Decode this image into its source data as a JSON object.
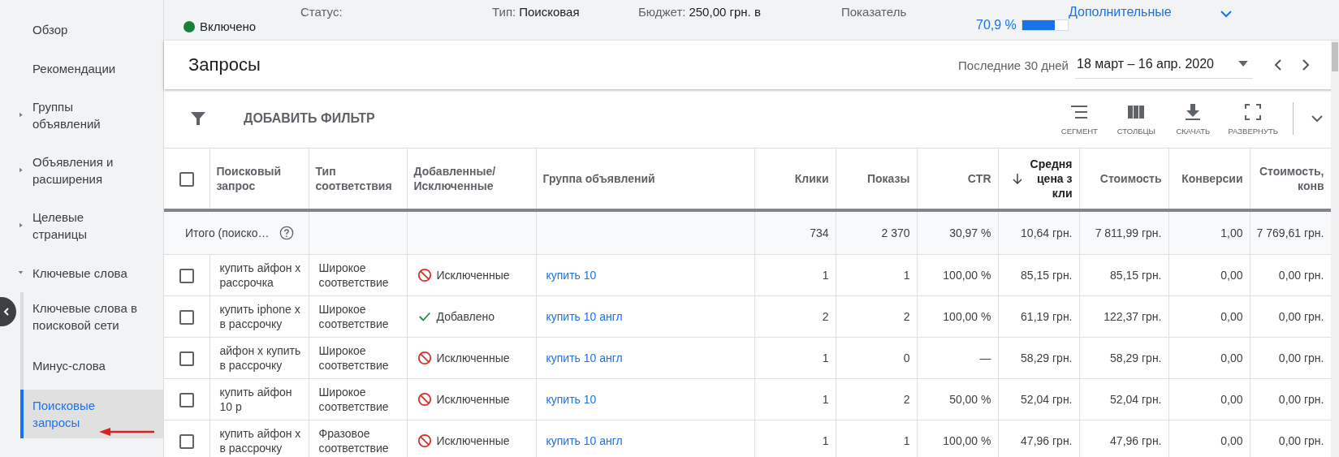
{
  "sidebar": {
    "items": [
      {
        "label": "Обзор",
        "kind": "page",
        "selected": false
      },
      {
        "label": "Рекомендации",
        "kind": "page",
        "selected": false
      },
      {
        "label": "Группы объявлений",
        "kind": "group",
        "expanded": false,
        "selected": false
      },
      {
        "label": "Объявления и расширения",
        "kind": "group",
        "expanded": false,
        "selected": false
      },
      {
        "label": "Целевые страницы",
        "kind": "group",
        "expanded": false,
        "selected": false
      },
      {
        "label": "Ключевые слова",
        "kind": "group",
        "expanded": true,
        "selected": false,
        "children": [
          {
            "label": "Ключевые слова в поисковой сети",
            "selected": false
          },
          {
            "label": "Минус-слова",
            "selected": false
          },
          {
            "label": "Поисковые запросы",
            "selected": true
          }
        ]
      }
    ]
  },
  "summary": {
    "status_label": "Статус:",
    "status_value": "Включено",
    "enabled": true,
    "type_label": "Тип:",
    "type_value": "Поисковая",
    "budget_label": "Бюджет:",
    "budget_value": "250,00 грн. в",
    "score_label": "Показатель",
    "score_value": "70,9 %",
    "level": 0.709,
    "more_link": "Дополнительные"
  },
  "page": {
    "title": "Запросы",
    "date_preset": "Последние 30 дней",
    "date_range": "18 март – 16 апр. 2020"
  },
  "toolbar": {
    "filter_button": "ДОБАВИТЬ ФИЛЬТР",
    "tools": [
      {
        "label": "СЕГМЕНТ",
        "kind": "segment"
      },
      {
        "label": "СТОЛБЦЫ",
        "kind": "columns"
      },
      {
        "label": "СКАЧАТЬ",
        "kind": "download"
      },
      {
        "label": "РАЗВЕРНУТЬ",
        "kind": "expand"
      }
    ]
  },
  "table": {
    "all_checked": false,
    "columns": [
      {
        "label": "Поисковый запрос",
        "kind": "text",
        "sorted": false
      },
      {
        "label": "Тип соответствия",
        "kind": "text",
        "sorted": false
      },
      {
        "label": "Добавленные/ Исключенные",
        "kind": "text",
        "sorted": false
      },
      {
        "label": "Группа объявлений",
        "kind": "text",
        "sorted": false
      },
      {
        "label": "Клики",
        "kind": "number",
        "sorted": false
      },
      {
        "label": "Показы",
        "kind": "number",
        "sorted": false
      },
      {
        "label": "CTR",
        "kind": "number",
        "sorted": false
      },
      {
        "label": "Средня\nцена з\nкли",
        "kind": "number",
        "sorted": true
      },
      {
        "label": "Стоимость",
        "kind": "number",
        "sorted": false
      },
      {
        "label": "Конверсии",
        "kind": "number",
        "sorted": false
      },
      {
        "label": "Стоимость,\nконв",
        "kind": "number",
        "sorted": false
      }
    ],
    "total": {
      "label": "Итого (поиско…",
      "values": [
        "734",
        "2 370",
        "30,97 %",
        "10,64 грн.",
        "7 811,99 грн.",
        "1,00",
        "7 769,61 грн."
      ]
    },
    "rows": [
      {
        "checked": false,
        "query": "купить айфон х рассрочка",
        "match": "Широкое соответствие",
        "kind": "excluded",
        "status_label": "Исключенные",
        "group": "купить 10",
        "values": [
          "1",
          "1",
          "100,00 %",
          "85,15 грн.",
          "85,15 грн.",
          "0,00",
          "0,00 грн."
        ]
      },
      {
        "checked": false,
        "query": "купить iphone х в рассрочку",
        "match": "Широкое соответствие",
        "kind": "added",
        "status_label": "Добавлено",
        "group": "купить 10 англ",
        "values": [
          "2",
          "2",
          "100,00 %",
          "61,19 грн.",
          "122,37 грн.",
          "0,00",
          "0,00 грн."
        ]
      },
      {
        "checked": false,
        "query": "айфон х купить в рассрочку",
        "match": "Широкое соответствие",
        "kind": "excluded",
        "status_label": "Исключенные",
        "group": "купить 10 англ",
        "values": [
          "1",
          "0",
          "—",
          "58,29 грн.",
          "58,29 грн.",
          "0,00",
          "0,00 грн."
        ]
      },
      {
        "checked": false,
        "query": "купить айфон 10 р",
        "match": "Широкое соответствие",
        "kind": "excluded",
        "status_label": "Исключенные",
        "group": "купить 10",
        "values": [
          "1",
          "2",
          "50,00 %",
          "52,04 грн.",
          "52,04 грн.",
          "0,00",
          "0,00 грн."
        ]
      },
      {
        "checked": false,
        "query": "купить айфон х в рассрочку",
        "match": "Фразовое соответствие",
        "kind": "excluded",
        "status_label": "Исключенные",
        "group": "купить 10 англ",
        "values": [
          "1",
          "1",
          "100,00 %",
          "47,96 грн.",
          "47,96 грн.",
          "0,00",
          "0,00 грн."
        ]
      }
    ]
  }
}
